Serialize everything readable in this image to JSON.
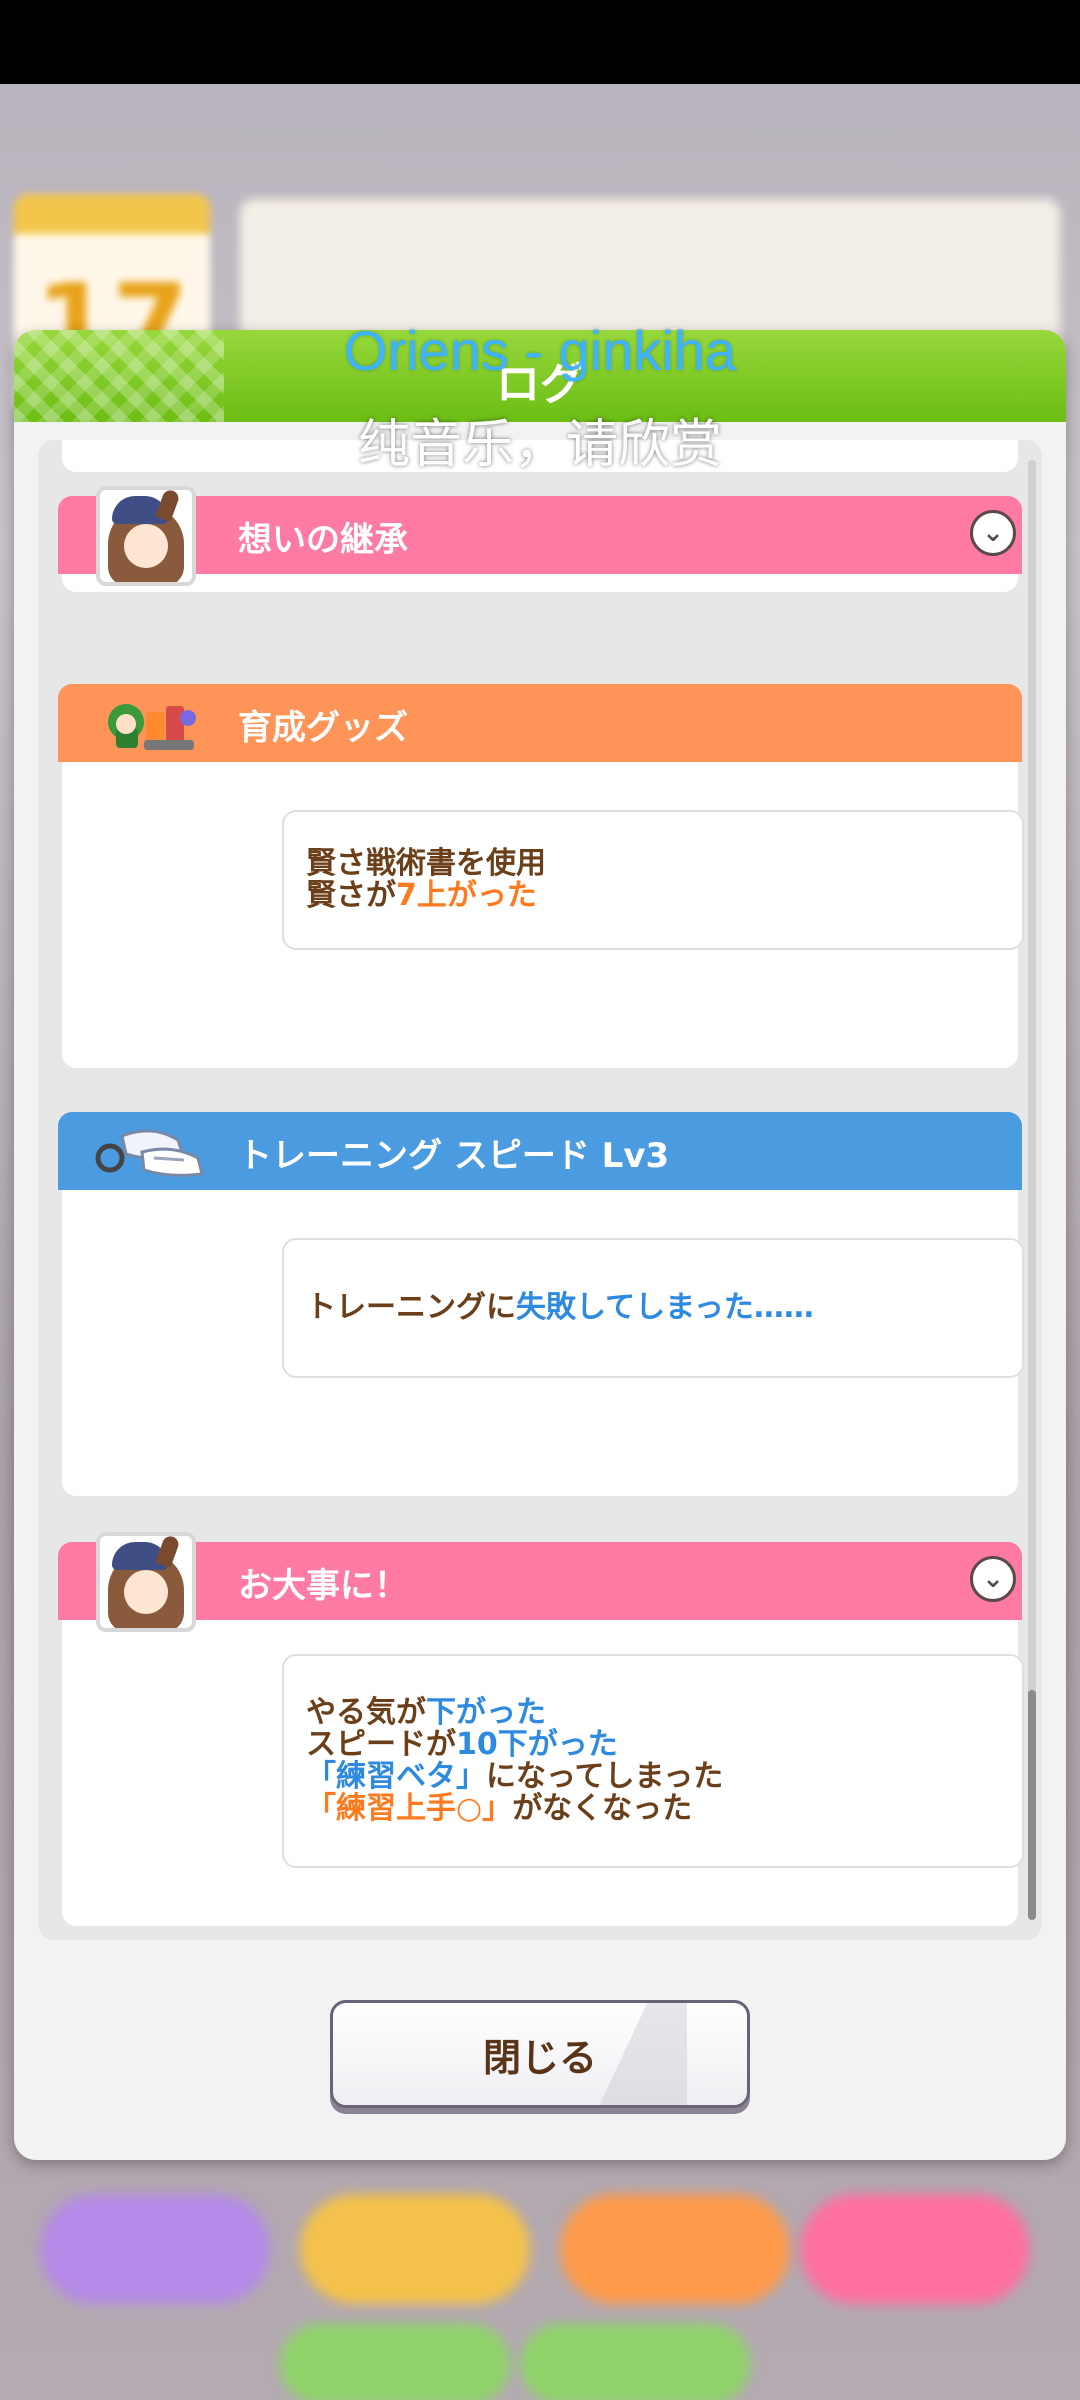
{
  "overlay": {
    "song_caption": "Oriens - ginkiha",
    "subtitle": "纯音乐，请欣赏"
  },
  "background": {
    "date_number": "17"
  },
  "dialog": {
    "title": "ログ",
    "close_label": "閉じる"
  },
  "log": {
    "entries": [
      {
        "title": "想いの継承",
        "color": "#ff7ba4",
        "icon": "character-portrait-icon",
        "expandable": true,
        "lines": []
      },
      {
        "title": "育成グッズ",
        "color": "#ff9458",
        "icon": "training-goods-icon",
        "expandable": false,
        "lines": [
          [
            "賢さ戦術書を使用"
          ],
          [
            "賢さが",
            "7上がった"
          ]
        ]
      },
      {
        "title": "トレーニング スピード Lv3",
        "color": "#4a9be0",
        "icon": "shoes-icon",
        "expandable": false,
        "lines": [
          [
            "トレーニングに",
            "失敗してしまった……"
          ]
        ]
      },
      {
        "title": "お大事に！",
        "color": "#ff7ba4",
        "icon": "character-portrait-icon",
        "expandable": true,
        "lines": [
          [
            "やる気が",
            "下がった"
          ],
          [
            "スピードが",
            "10下がった"
          ],
          [
            "「練習ベタ」",
            "になってしまった"
          ],
          [
            "「練習上手○」",
            "がなくなった"
          ]
        ]
      }
    ]
  },
  "colors": {
    "header_green": "#6cbd14",
    "text_brown": "#6b3f19",
    "highlight_orange": "#ff7a1e",
    "highlight_blue": "#2e8ae0"
  }
}
